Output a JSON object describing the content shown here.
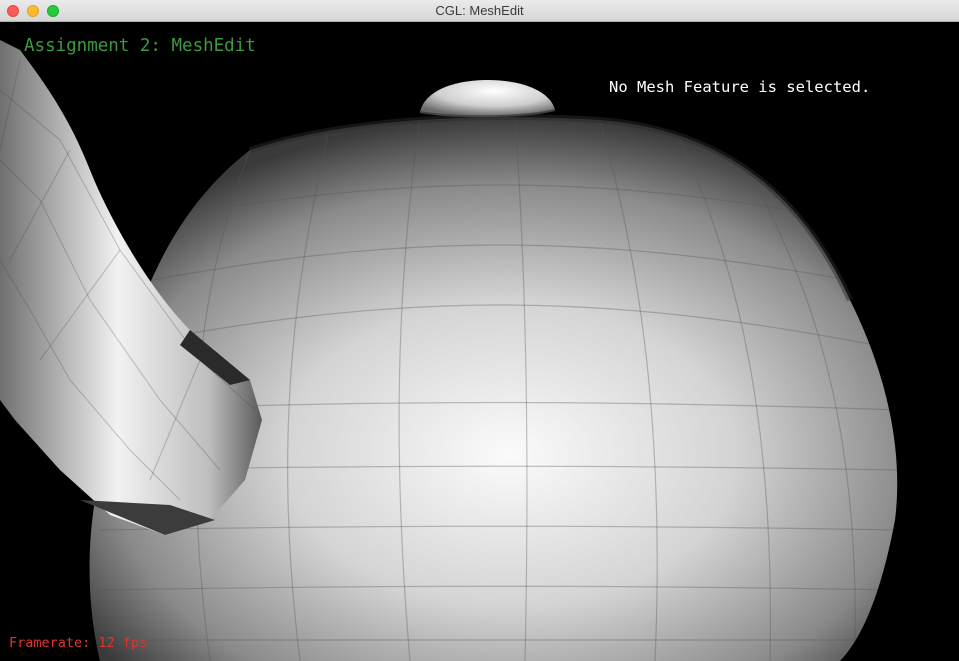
{
  "window": {
    "title": "CGL: MeshEdit"
  },
  "viewport": {
    "heading": "Assignment 2: MeshEdit",
    "selection_status": "No Mesh Feature is selected.",
    "framerate": "Framerate: 12 fps",
    "model": "teapot-mesh",
    "colors": {
      "background": "#000000",
      "heading": "#3d9a3d",
      "status": "#ffffff",
      "framerate": "#e2332e"
    }
  }
}
